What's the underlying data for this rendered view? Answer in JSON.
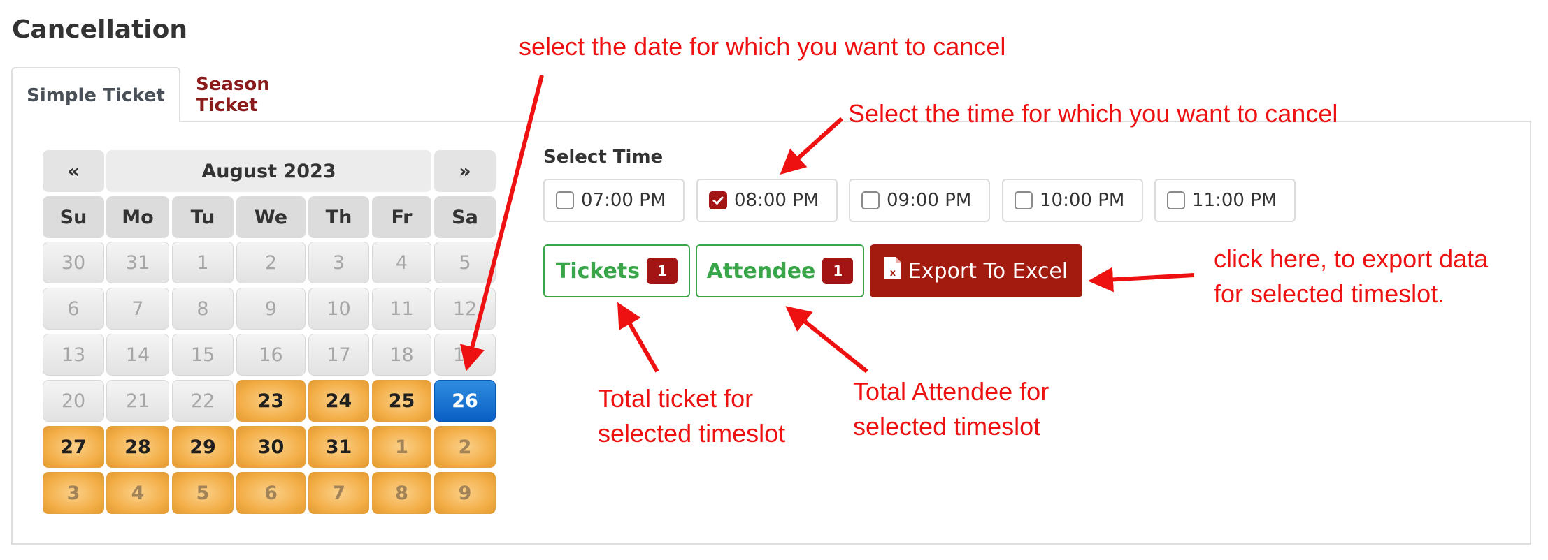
{
  "page_title": "Cancellation",
  "tabs": [
    {
      "label": "Simple Ticket",
      "active": true
    },
    {
      "label": "Season Ticket",
      "active": false
    }
  ],
  "calendar": {
    "prev_label": "«",
    "next_label": "»",
    "month_label": "August 2023",
    "weekdays": [
      "Su",
      "Mo",
      "Tu",
      "We",
      "Th",
      "Fr",
      "Sa"
    ],
    "weeks": [
      [
        {
          "d": "30",
          "s": "off"
        },
        {
          "d": "31",
          "s": "off"
        },
        {
          "d": "1",
          "s": "off"
        },
        {
          "d": "2",
          "s": "off"
        },
        {
          "d": "3",
          "s": "off"
        },
        {
          "d": "4",
          "s": "off"
        },
        {
          "d": "5",
          "s": "off"
        }
      ],
      [
        {
          "d": "6",
          "s": "off"
        },
        {
          "d": "7",
          "s": "off"
        },
        {
          "d": "8",
          "s": "off"
        },
        {
          "d": "9",
          "s": "off"
        },
        {
          "d": "10",
          "s": "off"
        },
        {
          "d": "11",
          "s": "off"
        },
        {
          "d": "12",
          "s": "off"
        }
      ],
      [
        {
          "d": "13",
          "s": "off"
        },
        {
          "d": "14",
          "s": "off"
        },
        {
          "d": "15",
          "s": "off"
        },
        {
          "d": "16",
          "s": "off"
        },
        {
          "d": "17",
          "s": "off"
        },
        {
          "d": "18",
          "s": "off"
        },
        {
          "d": "19",
          "s": "off"
        }
      ],
      [
        {
          "d": "20",
          "s": "off"
        },
        {
          "d": "21",
          "s": "off"
        },
        {
          "d": "22",
          "s": "off"
        },
        {
          "d": "23",
          "s": "avail"
        },
        {
          "d": "24",
          "s": "avail"
        },
        {
          "d": "25",
          "s": "avail"
        },
        {
          "d": "26",
          "s": "selected"
        }
      ],
      [
        {
          "d": "27",
          "s": "avail"
        },
        {
          "d": "28",
          "s": "avail"
        },
        {
          "d": "29",
          "s": "avail"
        },
        {
          "d": "30",
          "s": "avail"
        },
        {
          "d": "31",
          "s": "avail"
        },
        {
          "d": "1",
          "s": "avail-other"
        },
        {
          "d": "2",
          "s": "avail-other"
        }
      ],
      [
        {
          "d": "3",
          "s": "avail-other"
        },
        {
          "d": "4",
          "s": "avail-other"
        },
        {
          "d": "5",
          "s": "avail-other"
        },
        {
          "d": "6",
          "s": "avail-other"
        },
        {
          "d": "7",
          "s": "avail-other"
        },
        {
          "d": "8",
          "s": "avail-other"
        },
        {
          "d": "9",
          "s": "avail-other"
        }
      ]
    ]
  },
  "time_section": {
    "label": "Select Time",
    "slots": [
      {
        "label": "07:00 PM",
        "checked": false
      },
      {
        "label": "08:00 PM",
        "checked": true
      },
      {
        "label": "09:00 PM",
        "checked": false
      },
      {
        "label": "10:00 PM",
        "checked": false
      },
      {
        "label": "11:00 PM",
        "checked": false
      }
    ]
  },
  "actions": {
    "tickets_label": "Tickets",
    "tickets_count": "1",
    "attendee_label": "Attendee",
    "attendee_count": "1",
    "export_label": "Export To Excel",
    "export_icon": "excel-file-icon"
  },
  "annotations": {
    "date_hint": "select the date for which you want to cancel",
    "time_hint": "Select the time for which you want  to cancel",
    "export_hint_1": "click here, to export data",
    "export_hint_2": "for selected timeslot.",
    "tickets_hint_1": "Total ticket for",
    "tickets_hint_2": "selected timeslot",
    "attendee_hint_1": "Total Attendee for",
    "attendee_hint_2": "selected timeslot"
  },
  "colors": {
    "accent_red": "#a31515",
    "success_green": "#3aa64a",
    "available_day": "#f3ae47",
    "selected_day": "#0a5fc4",
    "annotation_red": "#ee1111"
  }
}
